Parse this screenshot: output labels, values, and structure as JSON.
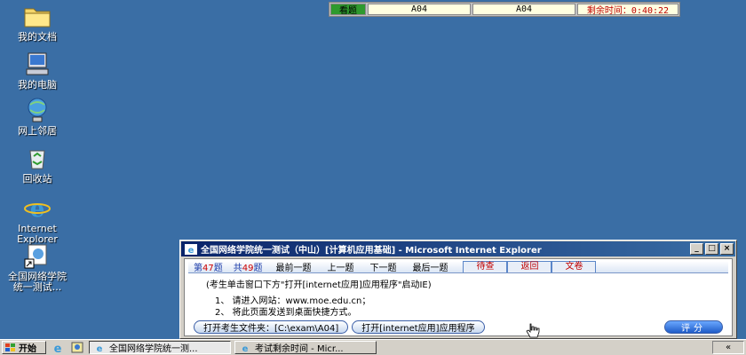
{
  "desktop_icons": [
    {
      "label": "我的文档",
      "icon": "folder-icon"
    },
    {
      "label": "我的电脑",
      "icon": "computer-icon"
    },
    {
      "label": "网上邻居",
      "icon": "network-icon"
    },
    {
      "label": "回收站",
      "icon": "recycle-bin-icon"
    },
    {
      "label_line1": "Internet",
      "label_line2": "Explorer",
      "icon": "ie-icon"
    },
    {
      "label_line1": "全国网络学院",
      "label_line2": "统一测试...",
      "icon": "shortcut-icon"
    }
  ],
  "topbar": {
    "see_label": "看题",
    "cell1": "A04",
    "cell2": "A04",
    "timer": "剩余时间：0:40:22"
  },
  "window": {
    "title": "全国网络学院统一测试（中山）[计算机应用基础] - Microsoft Internet Explorer",
    "nav": {
      "current_prefix": "第",
      "current_num": "47",
      "current_suffix": "题",
      "total_prefix": "共",
      "total_num": "49",
      "total_suffix": "题",
      "first": "最前一题",
      "prev": "上一题",
      "next": "下一题",
      "last": "最后一题",
      "pending": "待查",
      "back": "返回",
      "paper": "文卷"
    },
    "instruction": "(考生单击窗口下方\"打开[internet应用]应用程序\"启动IE)",
    "steps": [
      "1、 请进入网站：www.moe.edu.cn；",
      "2、 将此页面发送到桌面快捷方式。"
    ],
    "open_folder_label": "打开考生文件夹：[C:\\exam\\A04]",
    "open_app_label": "打开[internet应用]应用程序",
    "score_label": "评分"
  },
  "taskbar": {
    "start_label": "开始",
    "tasks": [
      "全国网络学院统一测...",
      "考试剩余时间 - Micr..."
    ],
    "tray": "«"
  },
  "colors": {
    "desktop": "#3a6ea5",
    "title_active": "#0a246a",
    "accent_red": "#c00000",
    "see_green": "#2e9a2e"
  }
}
